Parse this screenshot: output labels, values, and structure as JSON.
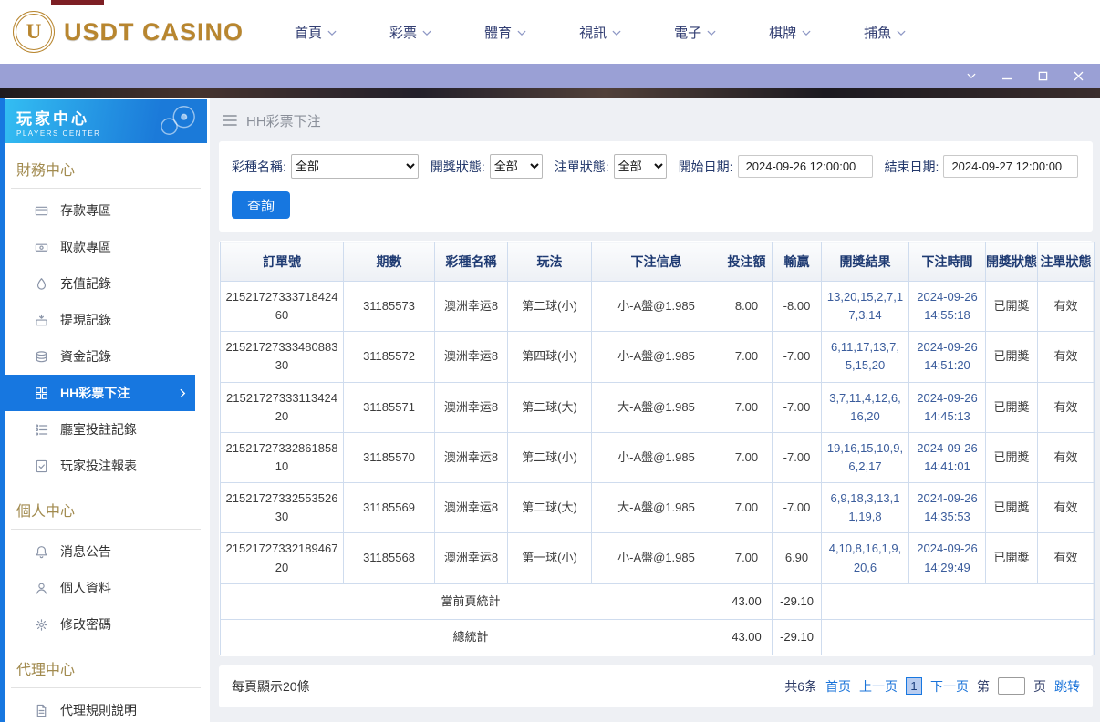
{
  "colors": {
    "accent": "#1777e0",
    "gold": "#b8862f",
    "topbar-purple": "#9aa0d5",
    "sidebar-gold": "#a18a4e",
    "table-border": "#cfdcee",
    "table-header-text": "#1f3b73",
    "link-blue": "#1a73d9",
    "page-bg": "#eef0f4"
  },
  "topnav": {
    "logo_letter": "U",
    "logo_text": "USDT CASINO",
    "items": [
      {
        "label": "首頁",
        "icon": "chevron-down"
      },
      {
        "label": "彩票",
        "icon": "chevron-down"
      },
      {
        "label": "體育",
        "icon": "chevron-down"
      },
      {
        "label": "視訊",
        "icon": "chevron-down"
      },
      {
        "label": "電子",
        "icon": "chevron-down"
      },
      {
        "label": "棋牌",
        "icon": "chevron-down"
      },
      {
        "label": "捕魚",
        "icon": "chevron-down"
      }
    ]
  },
  "window_controls": {
    "icons": [
      "chevron-down",
      "minimize",
      "maximize",
      "close"
    ]
  },
  "sidebar": {
    "title": "玩家中心",
    "subtitle": "PLAYERS CENTER",
    "sections": [
      {
        "heading": "財務中心",
        "items": [
          {
            "label": "存款專區",
            "icon": "deposit"
          },
          {
            "label": "取款專區",
            "icon": "withdraw"
          },
          {
            "label": "充值記錄",
            "icon": "recharge"
          },
          {
            "label": "提現記錄",
            "icon": "withdraw-record"
          },
          {
            "label": "資金記錄",
            "icon": "funds"
          },
          {
            "label": "HH彩票下注",
            "icon": "lottery",
            "active": true
          },
          {
            "label": "廳室投註記錄",
            "icon": "room-record"
          },
          {
            "label": "玩家投注報表",
            "icon": "report"
          }
        ]
      },
      {
        "heading": "個人中心",
        "items": [
          {
            "label": "消息公告",
            "icon": "announcement"
          },
          {
            "label": "個人資料",
            "icon": "profile"
          },
          {
            "label": "修改密碼",
            "icon": "password"
          }
        ]
      },
      {
        "heading": "代理中心",
        "items": [
          {
            "label": "代理規則說明",
            "icon": "document"
          }
        ]
      }
    ]
  },
  "content": {
    "page_title": "HH彩票下注",
    "filters": [
      {
        "label": "彩種名稱:",
        "value": "全部",
        "type": "select",
        "name": "lottery-type-select",
        "wide": true
      },
      {
        "label": "開獎狀態:",
        "value": "全部",
        "type": "select",
        "name": "draw-status-select"
      },
      {
        "label": "注單狀態:",
        "value": "全部",
        "type": "select",
        "name": "order-status-select"
      },
      {
        "label": "開始日期:",
        "value": "2024-09-26 12:00:00",
        "type": "input",
        "name": "start-date-input"
      },
      {
        "label": "結束日期:",
        "value": "2024-09-27 12:00:00",
        "type": "input",
        "name": "end-date-input"
      }
    ],
    "search_button": "查詢",
    "table": {
      "headers": [
        "訂單號",
        "期數",
        "彩種名稱",
        "玩法",
        "下注信息",
        "投注額",
        "輸贏",
        "開獎結果",
        "下注時間",
        "開獎狀態",
        "注單狀態"
      ],
      "rows": [
        [
          "2152172733371842460",
          "31185573",
          "澳洲幸运8",
          "第二球(小)",
          "小-A盤@1.985",
          "8.00",
          "-8.00",
          "13,20,15,2,7,17,3,14",
          "2024-09-26 14:55:18",
          "已開獎",
          "有效"
        ],
        [
          "2152172733348088330",
          "31185572",
          "澳洲幸运8",
          "第四球(小)",
          "小-A盤@1.985",
          "7.00",
          "-7.00",
          "6,11,17,13,7,5,15,20",
          "2024-09-26 14:51:20",
          "已開獎",
          "有效"
        ],
        [
          "2152172733311342420",
          "31185571",
          "澳洲幸运8",
          "第二球(大)",
          "大-A盤@1.985",
          "7.00",
          "-7.00",
          "3,7,11,4,12,6,16,20",
          "2024-09-26 14:45:13",
          "已開獎",
          "有效"
        ],
        [
          "2152172733286185810",
          "31185570",
          "澳洲幸运8",
          "第二球(小)",
          "小-A盤@1.985",
          "7.00",
          "-7.00",
          "19,16,15,10,9,6,2,17",
          "2024-09-26 14:41:01",
          "已開獎",
          "有效"
        ],
        [
          "2152172733255352630",
          "31185569",
          "澳洲幸运8",
          "第二球(大)",
          "大-A盤@1.985",
          "7.00",
          "-7.00",
          "6,9,18,3,13,11,19,8",
          "2024-09-26 14:35:53",
          "已開獎",
          "有效"
        ],
        [
          "2152172733218946720",
          "31185568",
          "澳洲幸运8",
          "第一球(小)",
          "小-A盤@1.985",
          "7.00",
          "6.90",
          "4,10,8,16,1,9,20,6",
          "2024-09-26 14:29:49",
          "已開獎",
          "有效"
        ]
      ],
      "page_summary": {
        "label": "當前頁統計",
        "bet": "43.00",
        "winloss": "-29.10"
      },
      "total_summary": {
        "label": "總統計",
        "bet": "43.00",
        "winloss": "-29.10"
      }
    },
    "footer": {
      "per_page": "每頁顯示20條",
      "total": "共6条",
      "first": "首页",
      "prev": "上一页",
      "current_page": "1",
      "next": "下一页",
      "jump_prefix": "第",
      "jump_suffix": "页",
      "jump": "跳转"
    }
  }
}
